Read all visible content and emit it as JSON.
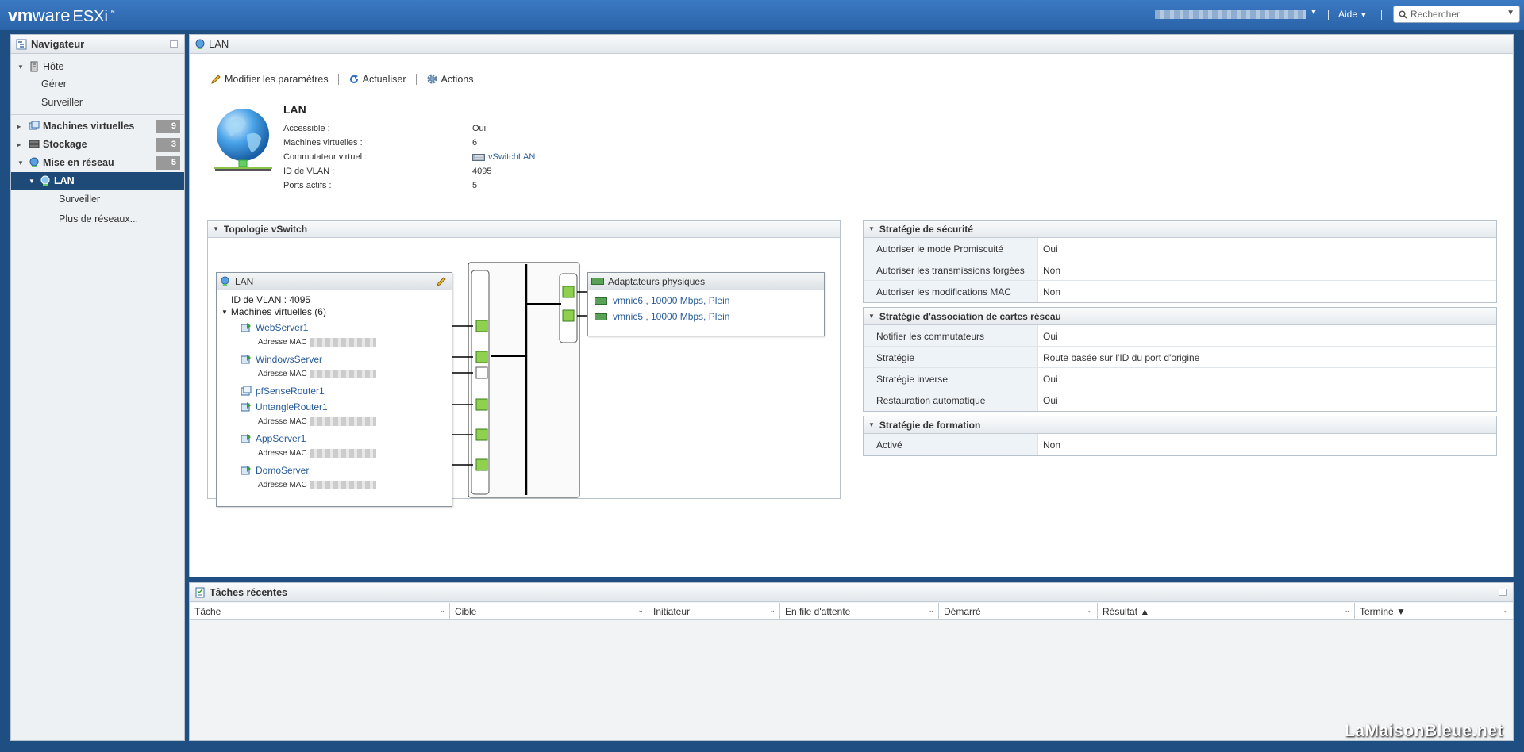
{
  "header": {
    "brand": "vm",
    "brand2": "ware",
    "product": "ESXi",
    "product_tm": "™",
    "help": "Aide",
    "search_placeholder": "Rechercher"
  },
  "navigator": {
    "title": "Navigateur",
    "host": "Hôte",
    "host_children": [
      "Gérer",
      "Surveiller"
    ],
    "vms": {
      "label": "Machines virtuelles",
      "count": "9"
    },
    "storage": {
      "label": "Stockage",
      "count": "3"
    },
    "network": {
      "label": "Mise en réseau",
      "count": "5"
    },
    "lan": "LAN",
    "lan_children": [
      "Surveiller",
      "Plus de réseaux..."
    ]
  },
  "main": {
    "title": "LAN",
    "toolbar": {
      "edit": "Modifier les paramètres",
      "refresh": "Actualiser",
      "actions": "Actions"
    },
    "info": {
      "name": "LAN",
      "rows": [
        {
          "label": "Accessible :",
          "value": "Oui"
        },
        {
          "label": "Machines virtuelles :",
          "value": "6"
        },
        {
          "label": "Commutateur virtuel :",
          "value": "vSwitchLAN"
        },
        {
          "label": "ID de VLAN :",
          "value": "4095"
        },
        {
          "label": "Ports actifs :",
          "value": "5"
        }
      ]
    },
    "topology": {
      "title": "Topologie vSwitch",
      "pg_name": "LAN",
      "vlan": "ID de VLAN : 4095",
      "vms_header": "Machines virtuelles (6)",
      "mac_label": "Adresse MAC",
      "vms": [
        "WebServer1",
        "WindowsServer",
        "pfSenseRouter1",
        "UntangleRouter1",
        "AppServer1",
        "DomoServer"
      ],
      "adapters_title": "Adaptateurs physiques",
      "nics": [
        "vmnic6 , 10000 Mbps, Plein",
        "vmnic5 , 10000 Mbps, Plein"
      ]
    },
    "security": {
      "title": "Stratégie de sécurité",
      "rows": [
        {
          "k": "Autoriser le mode Promiscuité",
          "v": "Oui"
        },
        {
          "k": "Autoriser les transmissions forgées",
          "v": "Non"
        },
        {
          "k": "Autoriser les modifications MAC",
          "v": "Non"
        }
      ]
    },
    "teaming": {
      "title": "Stratégie d'association de cartes réseau",
      "rows": [
        {
          "k": "Notifier les commutateurs",
          "v": "Oui"
        },
        {
          "k": "Stratégie",
          "v": "Route basée sur l'ID du port d'origine"
        },
        {
          "k": "Stratégie inverse",
          "v": "Oui"
        },
        {
          "k": "Restauration automatique",
          "v": "Oui"
        }
      ]
    },
    "shaping": {
      "title": "Stratégie de formation",
      "rows": [
        {
          "k": "Activé",
          "v": "Non"
        }
      ]
    }
  },
  "tasks": {
    "title": "Tâches récentes",
    "columns": [
      "Tâche",
      "Cible",
      "Initiateur",
      "En file d'attente",
      "Démarré",
      "Résultat ▲",
      "Terminé ▼"
    ]
  },
  "watermark": "LaMaisonBleue.net",
  "colors": {
    "topbar": "#2a63a8",
    "selected": "#1e4a78",
    "link": "#2a5d9a",
    "port_green": "#8fd14f"
  }
}
